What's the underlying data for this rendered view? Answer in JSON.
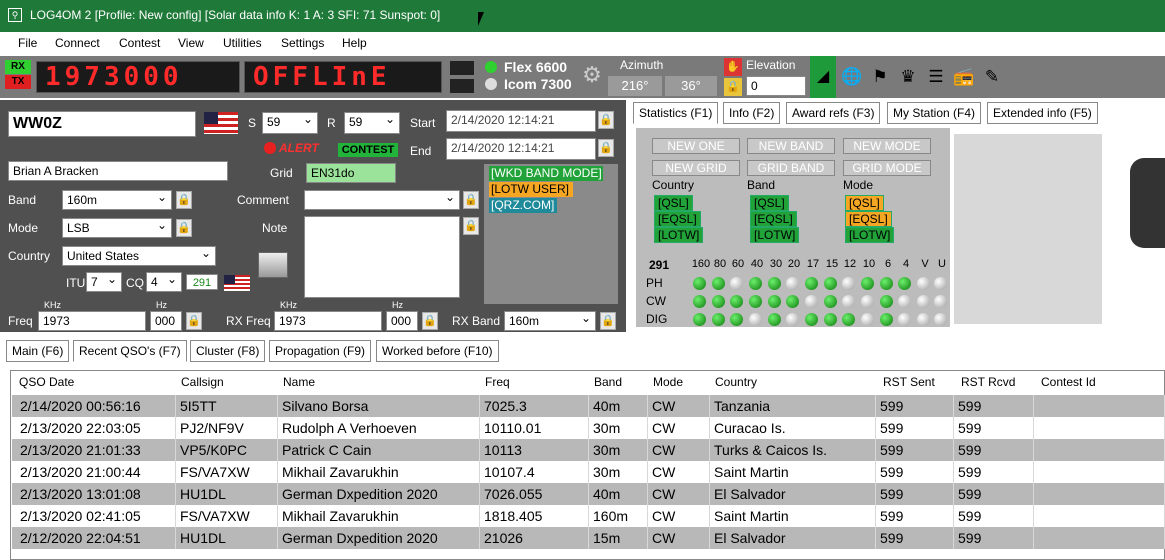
{
  "window": {
    "title": "LOG4OM 2 [Profile: New config] [Solar data info K: 1 A: 3 SFI: 71 Sunspot: 0]"
  },
  "menu": [
    "File",
    "Connect",
    "Contest",
    "View",
    "Utilities",
    "Settings",
    "Help"
  ],
  "toolbar": {
    "rx_label": "RX",
    "tx_label": "TX",
    "freq_display": "1973000",
    "mode_display": "OFFLInE",
    "radio1": "Flex 6600",
    "radio2": "Icom 7300",
    "azimuth_label": "Azimuth",
    "azimuth_sp": "216°",
    "azimuth_lp": "36°",
    "elevation_label": "Elevation",
    "elevation_value": "0"
  },
  "qso": {
    "callsign": "WW0Z",
    "s_label": "S",
    "s_value": "59",
    "r_label": "R",
    "r_value": "59",
    "start_label": "Start",
    "start_value": "2/14/2020 12:14:21",
    "end_label": "End",
    "end_value": "2/14/2020 12:14:21",
    "alert_label": "ALERT",
    "contest_label": "CONTEST",
    "name": "Brian A Bracken",
    "grid_label": "Grid",
    "grid_value": "EN31do",
    "band_label": "Band",
    "band_value": "160m",
    "mode_label": "Mode",
    "mode_value": "LSB",
    "country_label": "Country",
    "country_value": "United States",
    "comment_label": "Comment",
    "note_label": "Note",
    "itu_label": "ITU",
    "itu_value": "7",
    "cq_label": "CQ",
    "cq_value": "4",
    "dxcc_value": "291",
    "khz_label": "KHz",
    "hz_label": "Hz",
    "freq_label": "Freq",
    "freq_value": "1973",
    "freq_hz": "000",
    "rxfreq_label": "RX Freq",
    "rxfreq_value": "1973",
    "rxfreq_hz": "000",
    "rxband_label": "RX Band",
    "rxband_value": "160m",
    "status_tags": [
      "[WKD BAND MODE]",
      "[LOTW USER]",
      "[QRZ.COM]"
    ]
  },
  "right_tabs": [
    "Statistics (F1)",
    "Info (F2)",
    "Award refs (F3)",
    "My Station (F4)",
    "Extended info (F5)"
  ],
  "stats": {
    "buttons": [
      "NEW ONE",
      "NEW BAND",
      "NEW MODE",
      "NEW GRID",
      "GRID BAND",
      "GRID MODE"
    ],
    "col_labels": [
      "Country",
      "Band",
      "Mode"
    ],
    "tags": [
      "[QSL]",
      "[EQSL]",
      "[LOTW]"
    ],
    "dxcc": "291",
    "bands": [
      "160",
      "80",
      "60",
      "40",
      "30",
      "20",
      "17",
      "15",
      "12",
      "10",
      "6",
      "4",
      "V",
      "U"
    ],
    "rows": [
      "PH",
      "CW",
      "DIG"
    ],
    "grid": [
      [
        1,
        1,
        0,
        1,
        1,
        0,
        1,
        1,
        0,
        1,
        1,
        1,
        0,
        0
      ],
      [
        1,
        1,
        1,
        1,
        1,
        1,
        0,
        1,
        0,
        0,
        1,
        0,
        0,
        0
      ],
      [
        1,
        1,
        1,
        0,
        1,
        0,
        1,
        1,
        1,
        0,
        1,
        0,
        0,
        0
      ]
    ]
  },
  "bottom_tabs": [
    "Main (F6)",
    "Recent QSO's (F7)",
    "Cluster (F8)",
    "Propagation (F9)",
    "Worked before (F10)"
  ],
  "table": {
    "columns": [
      "QSO Date",
      "Callsign",
      "Name",
      "Freq",
      "Band",
      "Mode",
      "Country",
      "RST Sent",
      "RST Rcvd",
      "Contest Id"
    ],
    "rows": [
      [
        "2/14/2020 00:56:16",
        "5I5TT",
        "Silvano Borsa",
        "7025.3",
        "40m",
        "CW",
        "Tanzania",
        "599",
        "599",
        ""
      ],
      [
        "2/13/2020 22:03:05",
        "PJ2/NF9V",
        "Rudolph A Verhoeven",
        "10110.01",
        "30m",
        "CW",
        "Curacao Is.",
        "599",
        "599",
        ""
      ],
      [
        "2/13/2020 21:01:33",
        "VP5/K0PC",
        "Patrick C Cain",
        "10113",
        "30m",
        "CW",
        "Turks & Caicos Is.",
        "599",
        "599",
        ""
      ],
      [
        "2/13/2020 21:00:44",
        "FS/VA7XW",
        "Mikhail Zavarukhin",
        "10107.4",
        "30m",
        "CW",
        "Saint Martin",
        "599",
        "599",
        ""
      ],
      [
        "2/13/2020 13:01:08",
        "HU1DL",
        "German Dxpedition 2020",
        "7026.055",
        "40m",
        "CW",
        "El Salvador",
        "599",
        "599",
        ""
      ],
      [
        "2/13/2020 02:41:05",
        "FS/VA7XW",
        "Mikhail Zavarukhin",
        "1818.405",
        "160m",
        "CW",
        "Saint Martin",
        "599",
        "599",
        ""
      ],
      [
        "2/12/2020 22:04:51",
        "HU1DL",
        "German Dxpedition 2020",
        "21026",
        "15m",
        "CW",
        "El Salvador",
        "599",
        "599",
        ""
      ]
    ]
  }
}
